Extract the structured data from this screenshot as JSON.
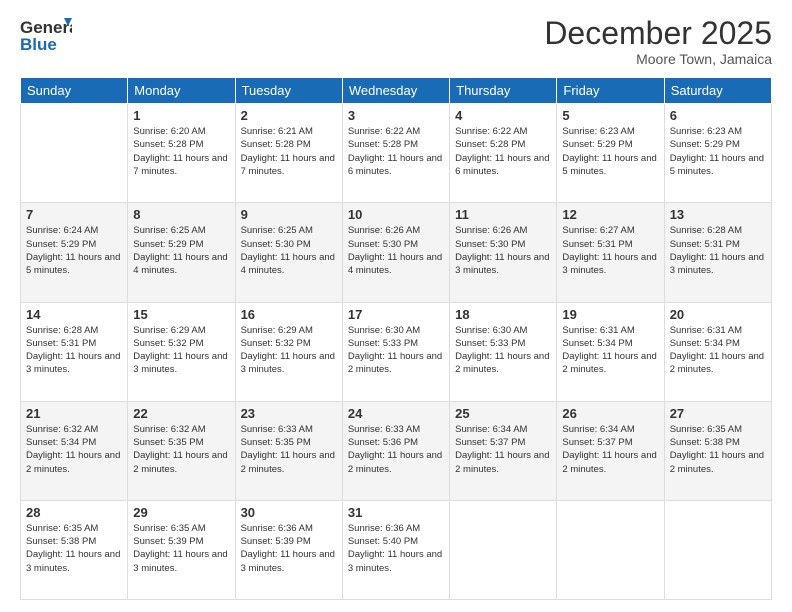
{
  "header": {
    "logo_line1": "General",
    "logo_line2": "Blue",
    "month": "December 2025",
    "location": "Moore Town, Jamaica"
  },
  "weekdays": [
    "Sunday",
    "Monday",
    "Tuesday",
    "Wednesday",
    "Thursday",
    "Friday",
    "Saturday"
  ],
  "weeks": [
    [
      {
        "day": "",
        "sunrise": "",
        "sunset": "",
        "daylight": ""
      },
      {
        "day": "1",
        "sunrise": "Sunrise: 6:20 AM",
        "sunset": "Sunset: 5:28 PM",
        "daylight": "Daylight: 11 hours and 7 minutes."
      },
      {
        "day": "2",
        "sunrise": "Sunrise: 6:21 AM",
        "sunset": "Sunset: 5:28 PM",
        "daylight": "Daylight: 11 hours and 7 minutes."
      },
      {
        "day": "3",
        "sunrise": "Sunrise: 6:22 AM",
        "sunset": "Sunset: 5:28 PM",
        "daylight": "Daylight: 11 hours and 6 minutes."
      },
      {
        "day": "4",
        "sunrise": "Sunrise: 6:22 AM",
        "sunset": "Sunset: 5:28 PM",
        "daylight": "Daylight: 11 hours and 6 minutes."
      },
      {
        "day": "5",
        "sunrise": "Sunrise: 6:23 AM",
        "sunset": "Sunset: 5:29 PM",
        "daylight": "Daylight: 11 hours and 5 minutes."
      },
      {
        "day": "6",
        "sunrise": "Sunrise: 6:23 AM",
        "sunset": "Sunset: 5:29 PM",
        "daylight": "Daylight: 11 hours and 5 minutes."
      }
    ],
    [
      {
        "day": "7",
        "sunrise": "Sunrise: 6:24 AM",
        "sunset": "Sunset: 5:29 PM",
        "daylight": "Daylight: 11 hours and 5 minutes."
      },
      {
        "day": "8",
        "sunrise": "Sunrise: 6:25 AM",
        "sunset": "Sunset: 5:29 PM",
        "daylight": "Daylight: 11 hours and 4 minutes."
      },
      {
        "day": "9",
        "sunrise": "Sunrise: 6:25 AM",
        "sunset": "Sunset: 5:30 PM",
        "daylight": "Daylight: 11 hours and 4 minutes."
      },
      {
        "day": "10",
        "sunrise": "Sunrise: 6:26 AM",
        "sunset": "Sunset: 5:30 PM",
        "daylight": "Daylight: 11 hours and 4 minutes."
      },
      {
        "day": "11",
        "sunrise": "Sunrise: 6:26 AM",
        "sunset": "Sunset: 5:30 PM",
        "daylight": "Daylight: 11 hours and 3 minutes."
      },
      {
        "day": "12",
        "sunrise": "Sunrise: 6:27 AM",
        "sunset": "Sunset: 5:31 PM",
        "daylight": "Daylight: 11 hours and 3 minutes."
      },
      {
        "day": "13",
        "sunrise": "Sunrise: 6:28 AM",
        "sunset": "Sunset: 5:31 PM",
        "daylight": "Daylight: 11 hours and 3 minutes."
      }
    ],
    [
      {
        "day": "14",
        "sunrise": "Sunrise: 6:28 AM",
        "sunset": "Sunset: 5:31 PM",
        "daylight": "Daylight: 11 hours and 3 minutes."
      },
      {
        "day": "15",
        "sunrise": "Sunrise: 6:29 AM",
        "sunset": "Sunset: 5:32 PM",
        "daylight": "Daylight: 11 hours and 3 minutes."
      },
      {
        "day": "16",
        "sunrise": "Sunrise: 6:29 AM",
        "sunset": "Sunset: 5:32 PM",
        "daylight": "Daylight: 11 hours and 3 minutes."
      },
      {
        "day": "17",
        "sunrise": "Sunrise: 6:30 AM",
        "sunset": "Sunset: 5:33 PM",
        "daylight": "Daylight: 11 hours and 2 minutes."
      },
      {
        "day": "18",
        "sunrise": "Sunrise: 6:30 AM",
        "sunset": "Sunset: 5:33 PM",
        "daylight": "Daylight: 11 hours and 2 minutes."
      },
      {
        "day": "19",
        "sunrise": "Sunrise: 6:31 AM",
        "sunset": "Sunset: 5:34 PM",
        "daylight": "Daylight: 11 hours and 2 minutes."
      },
      {
        "day": "20",
        "sunrise": "Sunrise: 6:31 AM",
        "sunset": "Sunset: 5:34 PM",
        "daylight": "Daylight: 11 hours and 2 minutes."
      }
    ],
    [
      {
        "day": "21",
        "sunrise": "Sunrise: 6:32 AM",
        "sunset": "Sunset: 5:34 PM",
        "daylight": "Daylight: 11 hours and 2 minutes."
      },
      {
        "day": "22",
        "sunrise": "Sunrise: 6:32 AM",
        "sunset": "Sunset: 5:35 PM",
        "daylight": "Daylight: 11 hours and 2 minutes."
      },
      {
        "day": "23",
        "sunrise": "Sunrise: 6:33 AM",
        "sunset": "Sunset: 5:35 PM",
        "daylight": "Daylight: 11 hours and 2 minutes."
      },
      {
        "day": "24",
        "sunrise": "Sunrise: 6:33 AM",
        "sunset": "Sunset: 5:36 PM",
        "daylight": "Daylight: 11 hours and 2 minutes."
      },
      {
        "day": "25",
        "sunrise": "Sunrise: 6:34 AM",
        "sunset": "Sunset: 5:37 PM",
        "daylight": "Daylight: 11 hours and 2 minutes."
      },
      {
        "day": "26",
        "sunrise": "Sunrise: 6:34 AM",
        "sunset": "Sunset: 5:37 PM",
        "daylight": "Daylight: 11 hours and 2 minutes."
      },
      {
        "day": "27",
        "sunrise": "Sunrise: 6:35 AM",
        "sunset": "Sunset: 5:38 PM",
        "daylight": "Daylight: 11 hours and 2 minutes."
      }
    ],
    [
      {
        "day": "28",
        "sunrise": "Sunrise: 6:35 AM",
        "sunset": "Sunset: 5:38 PM",
        "daylight": "Daylight: 11 hours and 3 minutes."
      },
      {
        "day": "29",
        "sunrise": "Sunrise: 6:35 AM",
        "sunset": "Sunset: 5:39 PM",
        "daylight": "Daylight: 11 hours and 3 minutes."
      },
      {
        "day": "30",
        "sunrise": "Sunrise: 6:36 AM",
        "sunset": "Sunset: 5:39 PM",
        "daylight": "Daylight: 11 hours and 3 minutes."
      },
      {
        "day": "31",
        "sunrise": "Sunrise: 6:36 AM",
        "sunset": "Sunset: 5:40 PM",
        "daylight": "Daylight: 11 hours and 3 minutes."
      },
      {
        "day": "",
        "sunrise": "",
        "sunset": "",
        "daylight": ""
      },
      {
        "day": "",
        "sunrise": "",
        "sunset": "",
        "daylight": ""
      },
      {
        "day": "",
        "sunrise": "",
        "sunset": "",
        "daylight": ""
      }
    ]
  ]
}
